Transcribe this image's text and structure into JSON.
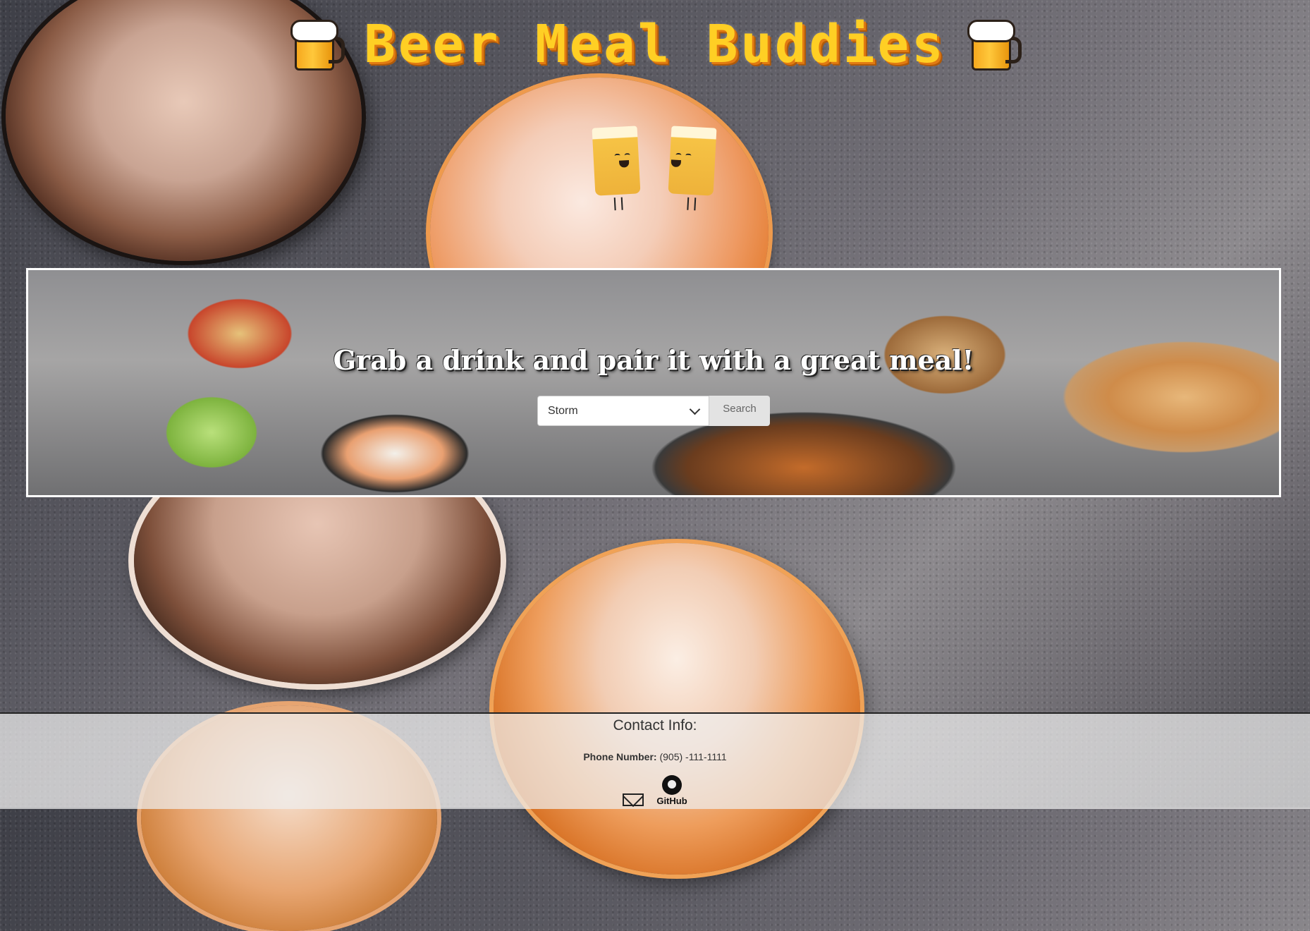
{
  "header": {
    "title": "Beer Meal Buddies",
    "left_icon": "beer-mug-icon",
    "right_icon": "beer-mug-icon"
  },
  "hero": {
    "tagline": "Grab a drink and pair it with a great meal!",
    "select": {
      "value": "Storm"
    },
    "search_label": "Search"
  },
  "footer": {
    "title": "Contact Info:",
    "phone_label": "Phone Number:",
    "phone_value": "(905) -111-1111",
    "github_label": "GitHub",
    "email_icon": "email-icon",
    "github_icon": "github-icon"
  },
  "colors": {
    "title_yellow": "#ffcf24",
    "title_shadow": "#e07a12"
  }
}
